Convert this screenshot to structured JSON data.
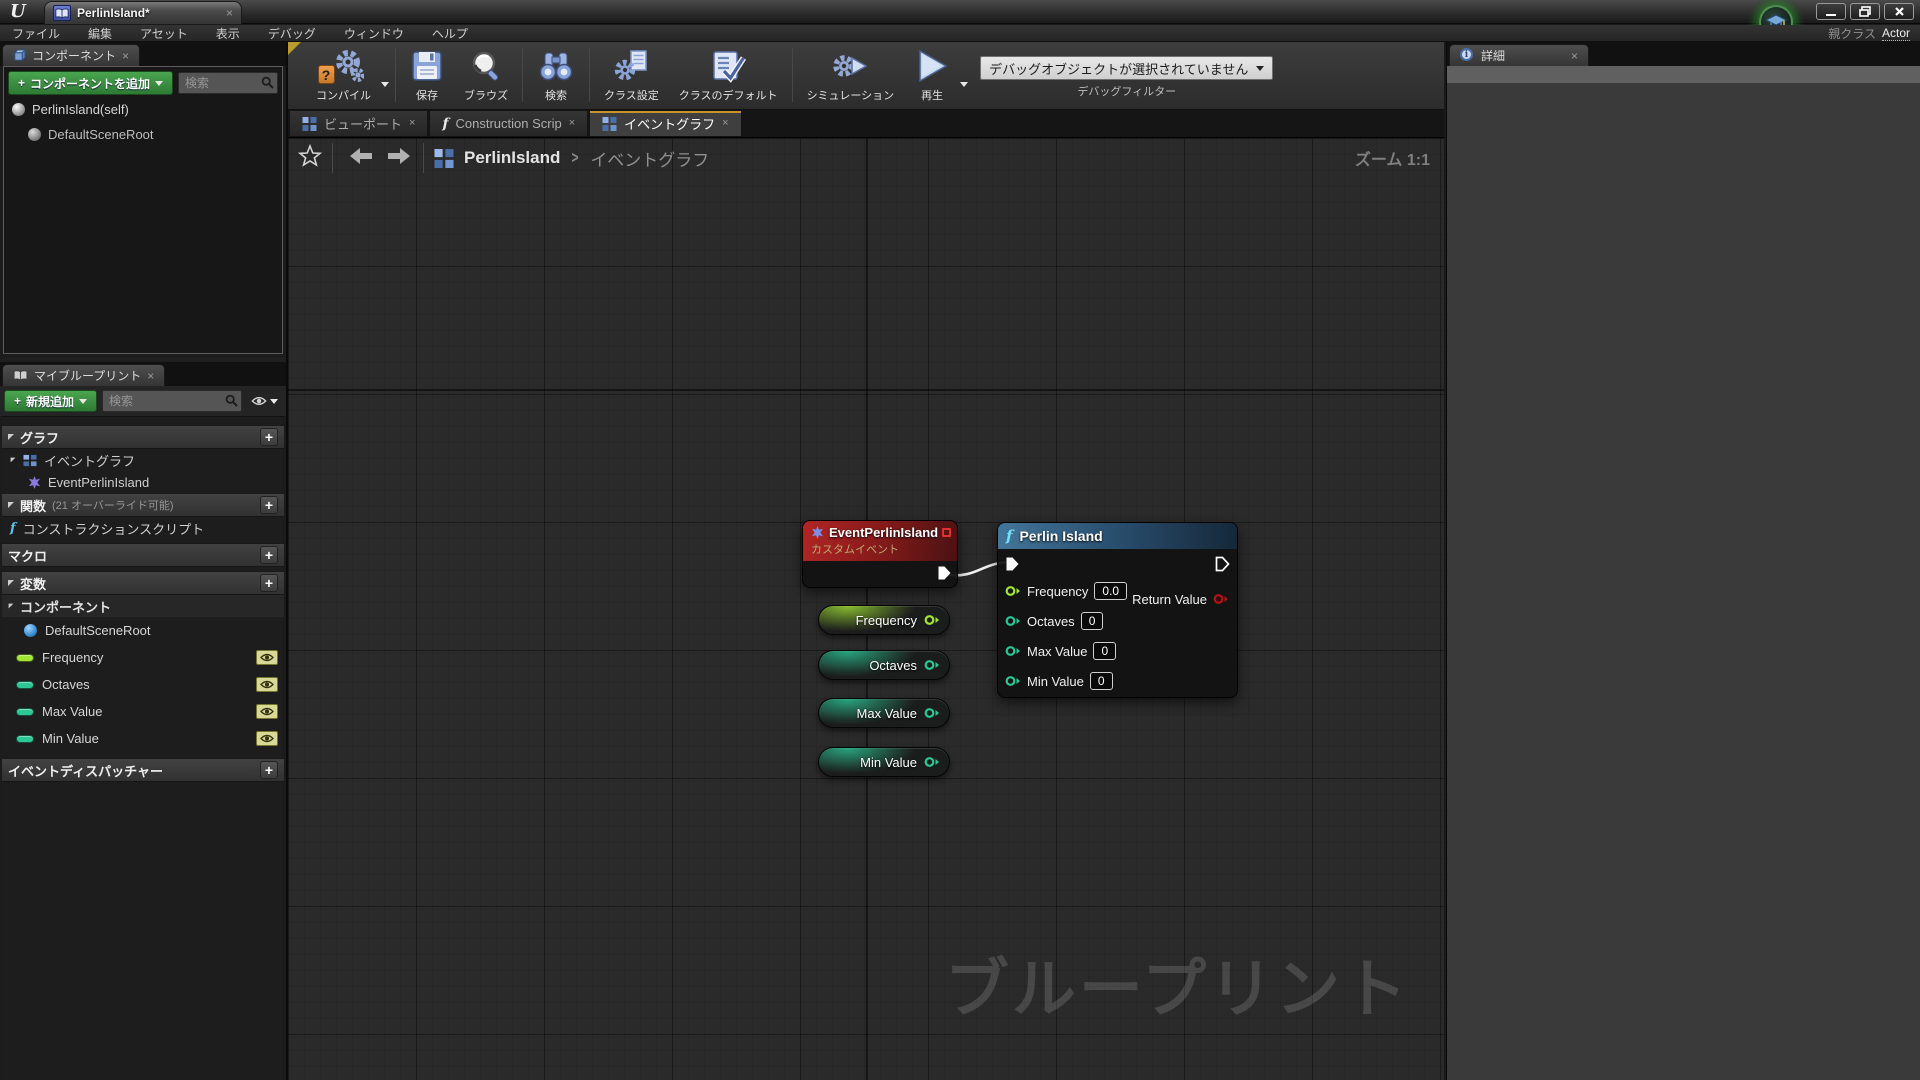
{
  "glyphs": {
    "close": "×",
    "plus": "+",
    "question": "?",
    "fn": "f",
    "logo": "U",
    "info": "i",
    "breadcrumb_sep": ">"
  },
  "colors": {
    "float_pin": "#a2e535",
    "int_pin": "#2cc795",
    "exec_pin": "#ffffff",
    "return_pin": "#b01414",
    "event_header_red": "#a32222",
    "function_header_blue": "#3f7196",
    "accent_green": "#3d9a43",
    "active_tab_highlight": "#c8932b",
    "wire": "#f0f0f0"
  },
  "titlebar": {
    "tab_title": "PerlinIsland*"
  },
  "menubar": {
    "items": [
      "ファイル",
      "編集",
      "アセット",
      "表示",
      "デバッグ",
      "ウィンドウ",
      "ヘルプ"
    ],
    "parent_class_label": "親クラス",
    "parent_class_value": "Actor"
  },
  "toolbar": {
    "compile": "コンパイル",
    "save": "保存",
    "browse": "ブラウズ",
    "find": "検索",
    "class_settings": "クラス設定",
    "class_defaults": "クラスのデフォルト",
    "simulate": "シミュレーション",
    "play": "再生",
    "debug_object_dropdown": "デバッグオブジェクトが選択されていません",
    "debug_filter_label": "デバッグフィルター"
  },
  "components_panel": {
    "tab_label": "コンポーネント",
    "add_button_label": "コンポーネントを追加",
    "search_placeholder": "検索",
    "items": [
      {
        "label": "PerlinIsland(self)"
      },
      {
        "label": "DefaultSceneRoot"
      }
    ]
  },
  "my_blueprint": {
    "tab_label": "マイブループリント",
    "add_button_label": "新規追加",
    "search_placeholder": "検索",
    "graphs_header": "グラフ",
    "event_graph_label": "イベントグラフ",
    "event_node_label": "EventPerlinIsland",
    "functions_header": "関数",
    "functions_note": "(21 オーバーライド可能)",
    "construction_script_label": "コンストラクションスクリプト",
    "macros_header": "マクロ",
    "variables_header": "変数",
    "components_subheader": "コンポーネント",
    "variables": [
      {
        "name": "DefaultSceneRoot"
      },
      {
        "name": "Frequency"
      },
      {
        "name": "Octaves"
      },
      {
        "name": "Max Value"
      },
      {
        "name": "Min Value"
      }
    ],
    "event_dispatchers_header": "イベントディスパッチャー"
  },
  "graph": {
    "tabs": [
      {
        "label": "ビューポート"
      },
      {
        "label": "Construction Scrip"
      },
      {
        "label": "イベントグラフ"
      }
    ],
    "breadcrumb": {
      "root": "PerlinIsland",
      "current": "イベントグラフ"
    },
    "zoom_label": "ズーム 1:1",
    "watermark": "ブループリント",
    "event_node": {
      "title": "EventPerlinIsland",
      "subtitle": "カスタムイベント"
    },
    "function_node": {
      "title": "Perlin Island",
      "inputs": [
        {
          "label": "Frequency",
          "value": "0.0"
        },
        {
          "label": "Octaves",
          "value": "0"
        },
        {
          "label": "Max Value",
          "value": "0"
        },
        {
          "label": "Min Value",
          "value": "0"
        }
      ],
      "output_label": "Return Value"
    },
    "variable_getters": [
      {
        "label": "Frequency"
      },
      {
        "label": "Octaves"
      },
      {
        "label": "Max Value"
      },
      {
        "label": "Min Value"
      }
    ]
  },
  "details_panel": {
    "tab_label": "詳細"
  }
}
